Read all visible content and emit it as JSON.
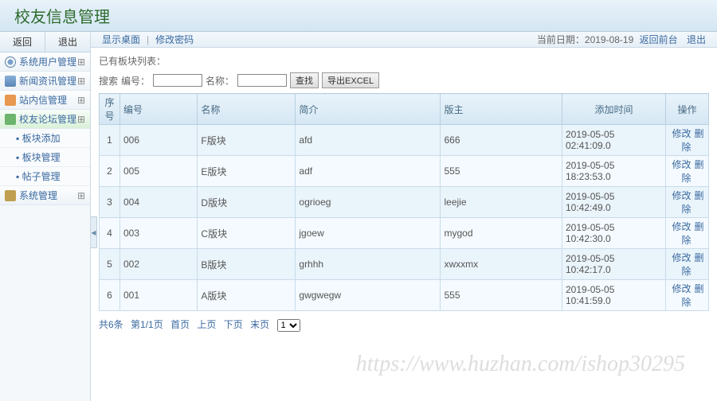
{
  "header": {
    "title": "校友信息管理"
  },
  "sidebar": {
    "back": "返回",
    "exit": "退出",
    "items": [
      {
        "label": "系统用户管理",
        "icon": "icon-sys"
      },
      {
        "label": "新闻资讯管理",
        "icon": "icon-news"
      },
      {
        "label": "站内信管理",
        "icon": "icon-site"
      },
      {
        "label": "校友论坛管理",
        "icon": "icon-forum",
        "active": true
      },
      {
        "label": "系统管理",
        "icon": "icon-cfg"
      }
    ],
    "subitems": [
      "板块添加",
      "板块管理",
      "帖子管理"
    ]
  },
  "breadcrumb": {
    "home": "显示桌面",
    "sep": "|",
    "pwd": "修改密码",
    "date_label": "当前日期：",
    "date": "2019-08-19",
    "back_link": "返回前台",
    "logout": "退出"
  },
  "list": {
    "title": "已有板块列表：",
    "search_label": "搜索",
    "field1": "编号：",
    "field2": "名称：",
    "btn_search": "查找",
    "btn_export": "导出EXCEL"
  },
  "table": {
    "headers": [
      "序号",
      "编号",
      "名称",
      "简介",
      "版主",
      "添加时间",
      "操作"
    ],
    "rows": [
      {
        "idx": "1",
        "no": "006",
        "name": "F版块",
        "desc": "afd",
        "owner": "666",
        "time": "2019-05-05 02:41:09.0"
      },
      {
        "idx": "2",
        "no": "005",
        "name": "E版块",
        "desc": "adf",
        "owner": "555",
        "time": "2019-05-05 18:23:53.0"
      },
      {
        "idx": "3",
        "no": "004",
        "name": "D版块",
        "desc": "ogrioeg",
        "owner": "leejie",
        "time": "2019-05-05 10:42:49.0"
      },
      {
        "idx": "4",
        "no": "003",
        "name": "C版块",
        "desc": "jgoew",
        "owner": "mygod",
        "time": "2019-05-05 10:42:30.0"
      },
      {
        "idx": "5",
        "no": "002",
        "name": "B版块",
        "desc": "grhhh",
        "owner": "xwxxmx",
        "time": "2019-05-05 10:42:17.0"
      },
      {
        "idx": "6",
        "no": "001",
        "name": "A版块",
        "desc": "gwgwegw",
        "owner": "555",
        "time": "2019-05-05 10:41:59.0"
      }
    ],
    "action_edit": "修改",
    "action_del": "删除"
  },
  "pager": {
    "total": "共6条",
    "page": "第1/1页",
    "first": "首页",
    "prev": "上页",
    "next": "下页",
    "last": "末页",
    "sel": "1"
  },
  "watermark": "https://www.huzhan.com/ishop30295"
}
